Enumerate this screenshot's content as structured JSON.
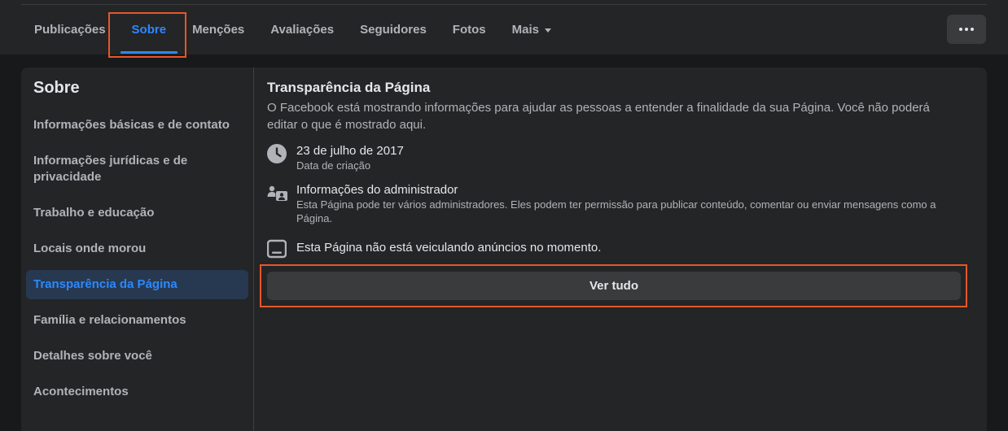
{
  "tabs": [
    {
      "label": "Publicações"
    },
    {
      "label": "Sobre"
    },
    {
      "label": "Menções"
    },
    {
      "label": "Avaliações"
    },
    {
      "label": "Seguidores"
    },
    {
      "label": "Fotos"
    },
    {
      "label": "Mais"
    }
  ],
  "active_tab": "Sobre",
  "sidebar": {
    "title": "Sobre",
    "items": [
      {
        "label": "Informações básicas e de contato"
      },
      {
        "label": "Informações jurídicas e de privacidade"
      },
      {
        "label": "Trabalho e educação"
      },
      {
        "label": "Locais onde morou"
      },
      {
        "label": "Transparência da Página"
      },
      {
        "label": "Família e relacionamentos"
      },
      {
        "label": "Detalhes sobre você"
      },
      {
        "label": "Acontecimentos"
      }
    ],
    "active_item": "Transparência da Página"
  },
  "transparency": {
    "title": "Transparência da Página",
    "description": "O Facebook está mostrando informações para ajudar as pessoas a entender a finalidade da sua Página. Você não poderá editar o que é mostrado aqui.",
    "rows": [
      {
        "icon": "clock-icon",
        "main": "23 de julho de 2017",
        "sub": "Data de criação"
      },
      {
        "icon": "admin-people-icon",
        "main": "Informações do administrador",
        "sub": "Esta Página pode ter vários administradores. Eles podem ter permissão para publicar conteúdo, comentar ou enviar mensagens como a Página."
      },
      {
        "icon": "ad-screen-icon",
        "main": "Esta Página não está veiculando anúncios no momento.",
        "sub": ""
      }
    ],
    "see_all_label": "Ver tudo"
  },
  "colors": {
    "background": "#18191a",
    "surface": "#242526",
    "accent": "#2d88ff",
    "highlight": "#e8562a"
  }
}
